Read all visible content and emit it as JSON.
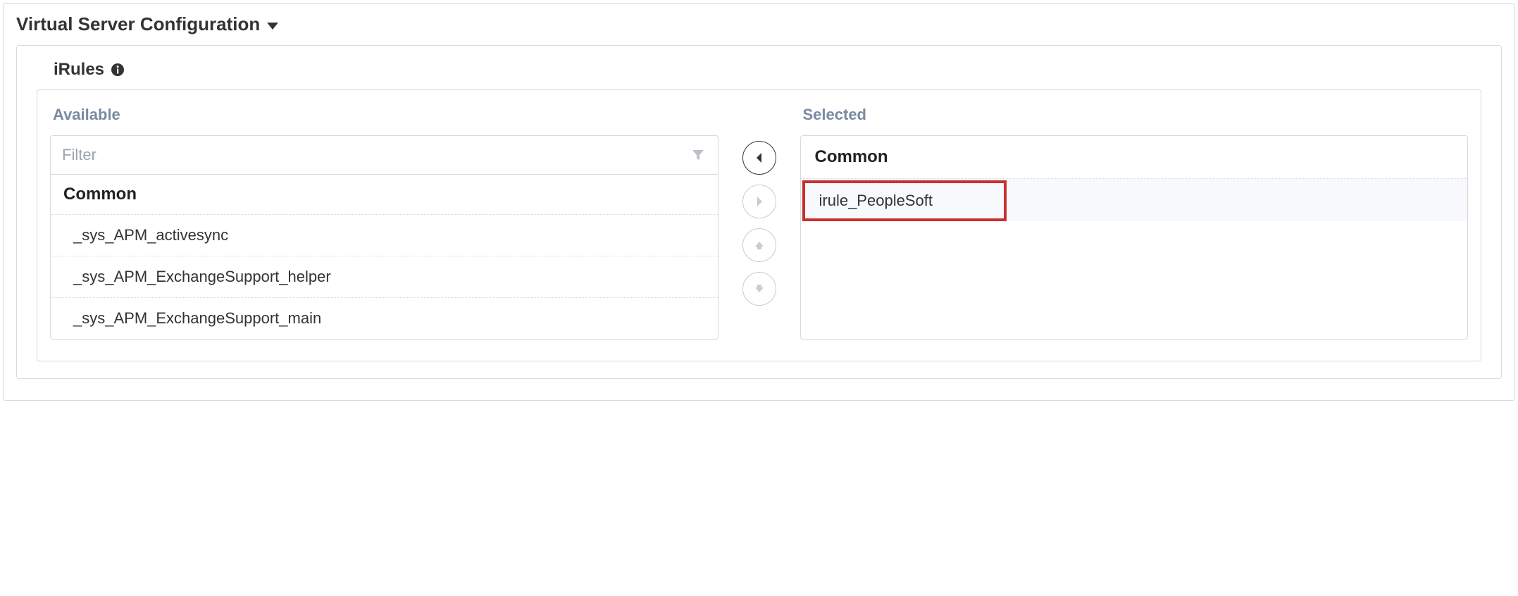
{
  "panel": {
    "title": "Virtual Server Configuration"
  },
  "section": {
    "label": "iRules"
  },
  "available": {
    "title": "Available",
    "filter_placeholder": "Filter",
    "group": "Common",
    "items": [
      "_sys_APM_activesync",
      "_sys_APM_ExchangeSupport_helper",
      "_sys_APM_ExchangeSupport_main"
    ]
  },
  "selected": {
    "title": "Selected",
    "group": "Common",
    "items": [
      "irule_PeopleSoft"
    ]
  }
}
